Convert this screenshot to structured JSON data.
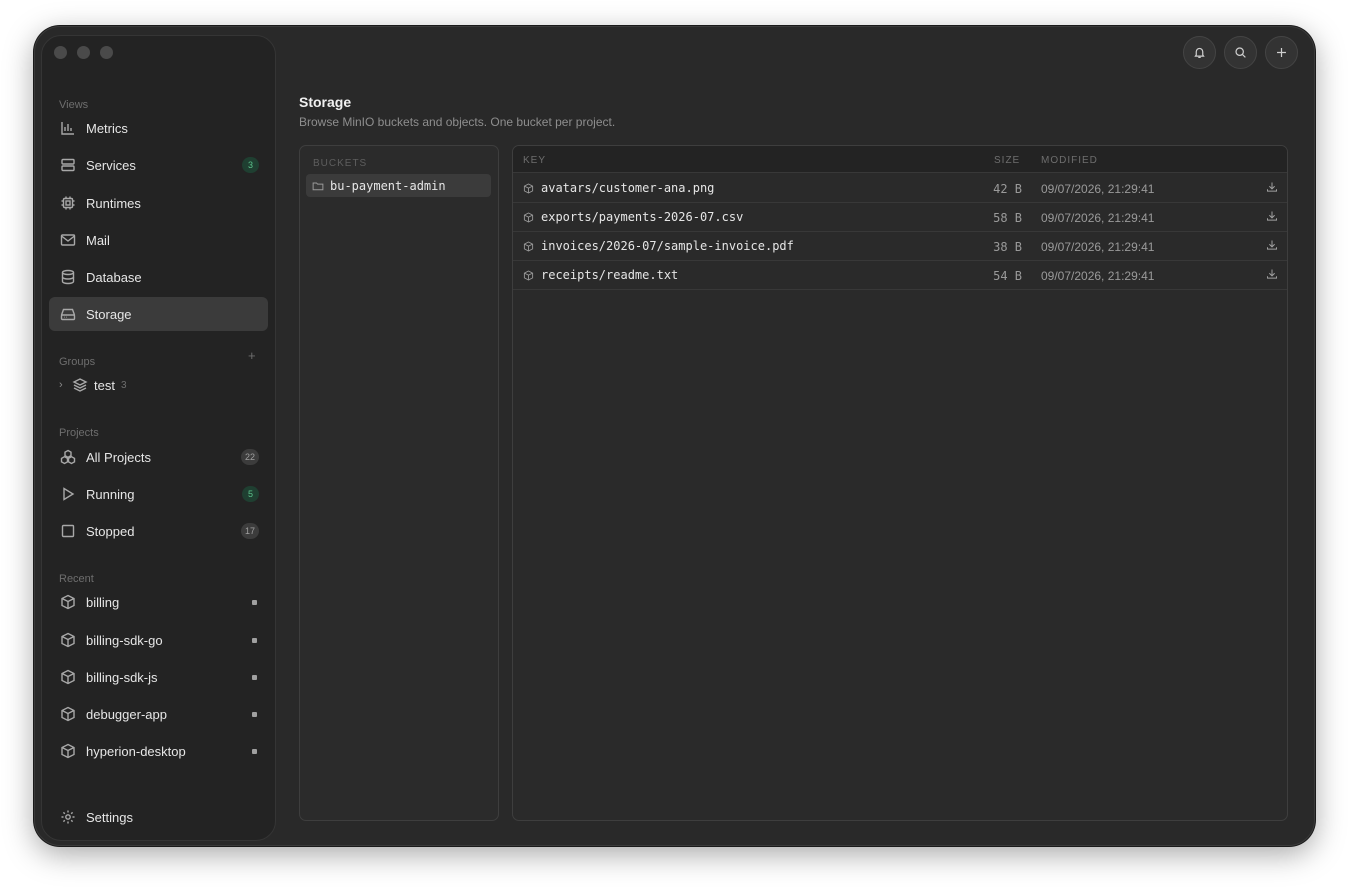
{
  "sidebar": {
    "sections": {
      "views": "Views",
      "groups": "Groups",
      "projects": "Projects",
      "recent": "Recent"
    },
    "views": [
      {
        "label": "Metrics",
        "icon": "bar-chart-icon"
      },
      {
        "label": "Services",
        "icon": "server-icon",
        "badge": "3"
      },
      {
        "label": "Runtimes",
        "icon": "cpu-icon"
      },
      {
        "label": "Mail",
        "icon": "mail-icon"
      },
      {
        "label": "Database",
        "icon": "database-icon"
      },
      {
        "label": "Storage",
        "icon": "hard-drive-icon",
        "active": true
      }
    ],
    "groups": [
      {
        "label": "test",
        "count": "3",
        "icon": "layers-icon"
      }
    ],
    "projects": [
      {
        "label": "All Projects",
        "badge": "22",
        "icon": "boxes-icon"
      },
      {
        "label": "Running",
        "badge": "5",
        "icon": "play-icon"
      },
      {
        "label": "Stopped",
        "badge": "17",
        "icon": "square-icon"
      }
    ],
    "recent": [
      {
        "label": "billing"
      },
      {
        "label": "billing-sdk-go"
      },
      {
        "label": "billing-sdk-js"
      },
      {
        "label": "debugger-app"
      },
      {
        "label": "hyperion-desktop"
      }
    ],
    "settings": "Settings"
  },
  "header": {
    "title": "Storage",
    "subtitle": "Browse MinIO buckets and objects. One bucket per project."
  },
  "buckets": {
    "heading": "BUCKETS",
    "items": [
      "bu-payment-admin"
    ]
  },
  "objects": {
    "columns": {
      "key": "KEY",
      "size": "SIZE",
      "modified": "MODIFIED"
    },
    "rows": [
      {
        "key": "avatars/customer-ana.png",
        "size": "42 B",
        "modified": "09/07/2026, 21:29:41"
      },
      {
        "key": "exports/payments-2026-07.csv",
        "size": "58 B",
        "modified": "09/07/2026, 21:29:41"
      },
      {
        "key": "invoices/2026-07/sample-invoice.pdf",
        "size": "38 B",
        "modified": "09/07/2026, 21:29:41"
      },
      {
        "key": "receipts/readme.txt",
        "size": "54 B",
        "modified": "09/07/2026, 21:29:41"
      }
    ]
  },
  "colors": {
    "background": "#292929",
    "sidebar": "#232323",
    "active": "#3b3b3b",
    "badge_green": "#5bc08a"
  }
}
